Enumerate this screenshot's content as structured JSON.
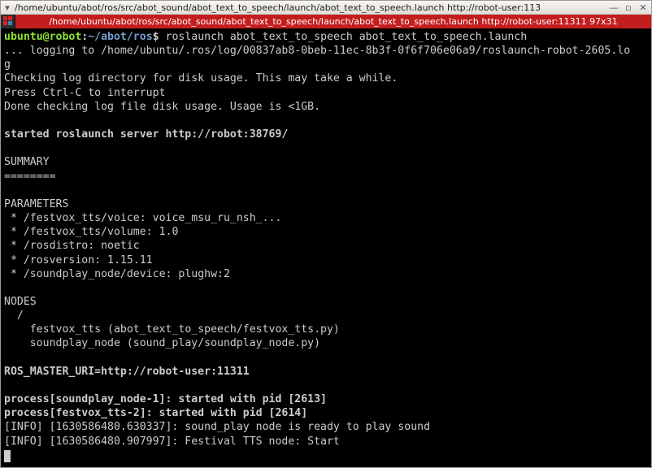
{
  "window": {
    "title": "/home/ubuntu/abot/ros/src/abot_sound/abot_text_to_speech/launch/abot_text_to_speech.launch http://robot-user:113"
  },
  "tabbar": {
    "active_tab": "/home/ubuntu/abot/ros/src/abot_sound/abot_text_to_speech/launch/abot_text_to_speech.launch http://robot-user:11311 97x31"
  },
  "prompt": {
    "userhost": "ubuntu@robot",
    "sep1": ":",
    "path": "~/abot/ros",
    "sep2": "$ ",
    "command": "roslaunch abot_text_to_speech abot_text_to_speech.launch"
  },
  "out": {
    "l1": "... logging to /home/ubuntu/.ros/log/00837ab8-0beb-11ec-8b3f-0f6f706e06a9/roslaunch-robot-2605.lo",
    "l2": "g",
    "l3": "Checking log directory for disk usage. This may take a while.",
    "l4": "Press Ctrl-C to interrupt",
    "l5": "Done checking log file disk usage. Usage is <1GB.",
    "l6": "",
    "l7": "started roslaunch server http://robot:38769/",
    "l8": "",
    "l9": "SUMMARY",
    "l10": "========",
    "l11": "",
    "l12": "PARAMETERS",
    "l13": " * /festvox_tts/voice: voice_msu_ru_nsh_...",
    "l14": " * /festvox_tts/volume: 1.0",
    "l15": " * /rosdistro: noetic",
    "l16": " * /rosversion: 1.15.11",
    "l17": " * /soundplay_node/device: plughw:2",
    "l18": "",
    "l19": "NODES",
    "l20": "  /",
    "l21": "    festvox_tts (abot_text_to_speech/festvox_tts.py)",
    "l22": "    soundplay_node (sound_play/soundplay_node.py)",
    "l23": "",
    "l24": "ROS_MASTER_URI=http://robot-user:11311",
    "l25": "",
    "l26": "process[soundplay_node-1]: started with pid [2613]",
    "l27": "process[festvox_tts-2]: started with pid [2614]",
    "l28": "[INFO] [1630586480.630337]: sound_play node is ready to play sound",
    "l29": "[INFO] [1630586480.907997]: Festival TTS node: Start"
  }
}
